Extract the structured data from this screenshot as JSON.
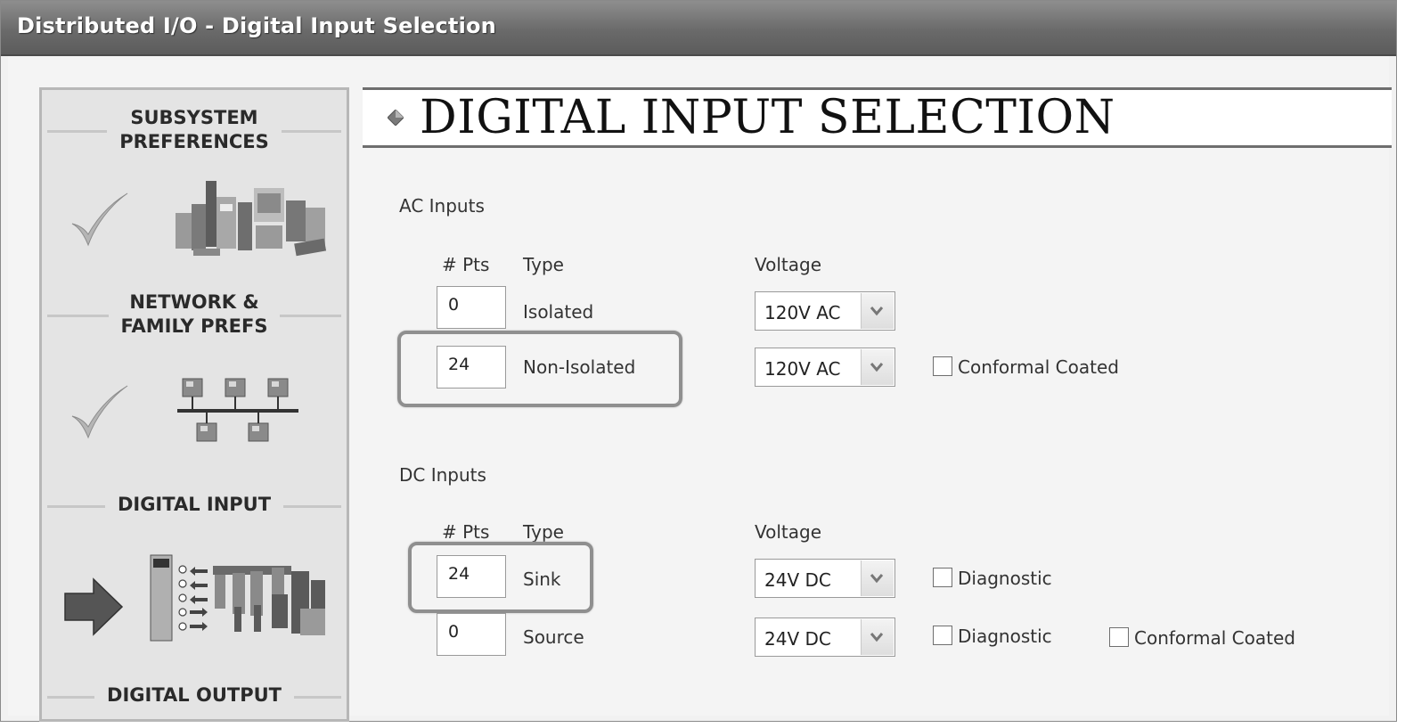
{
  "window": {
    "title": "Distributed I/O - Digital Input Selection"
  },
  "sidebar": {
    "steps": [
      {
        "label": "SUBSYSTEM\nPREFERENCES",
        "state": "complete",
        "icon": "subsystem-modules-icon"
      },
      {
        "label": "NETWORK &\nFAMILY PREFS",
        "state": "complete",
        "icon": "network-topology-icon"
      },
      {
        "label": "DIGITAL INPUT",
        "state": "current",
        "icon": "digital-input-modules-icon"
      },
      {
        "label": "DIGITAL OUTPUT",
        "state": "pending"
      }
    ]
  },
  "main": {
    "heading": "DIGITAL INPUT SELECTION",
    "ac_inputs": {
      "section_label": "AC Inputs",
      "col_pts": "# Pts",
      "col_type": "Type",
      "col_voltage": "Voltage",
      "rows": [
        {
          "pts": "0",
          "type": "Isolated",
          "voltage": "120V AC",
          "highlighted": false
        },
        {
          "pts": "24",
          "type": "Non-Isolated",
          "voltage": "120V AC",
          "highlighted": true,
          "checkbox": {
            "label": "Conformal Coated",
            "checked": false
          }
        }
      ]
    },
    "dc_inputs": {
      "section_label": "DC Inputs",
      "col_pts": "# Pts",
      "col_type": "Type",
      "col_voltage": "Voltage",
      "rows": [
        {
          "pts": "24",
          "type": "Sink",
          "voltage": "24V DC",
          "highlighted": true,
          "checkbox": {
            "label": "Diagnostic",
            "checked": false
          }
        },
        {
          "pts": "0",
          "type": "Source",
          "voltage": "24V DC",
          "highlighted": false,
          "checkbox": {
            "label": "Diagnostic",
            "checked": false
          },
          "checkbox2": {
            "label": "Conformal Coated",
            "checked": false
          }
        }
      ]
    }
  },
  "colors": {
    "titlebar": "#6a6a6a",
    "panel": "#e4e4e4",
    "highlight_border": "#8f8f8f"
  }
}
